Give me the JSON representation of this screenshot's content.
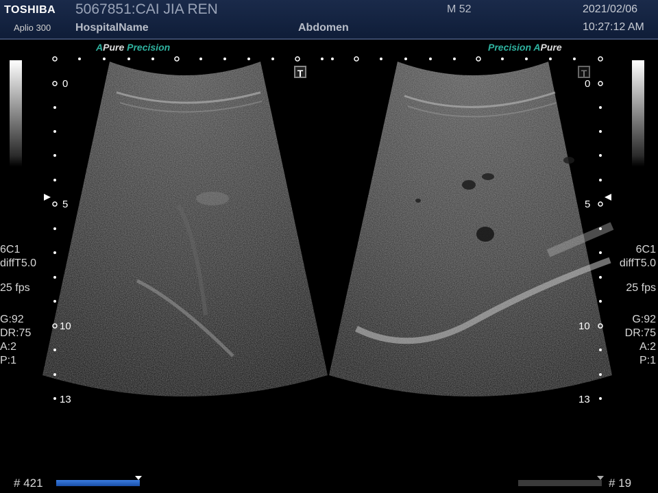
{
  "header": {
    "brand": "TOSHIBA",
    "model": "Aplio 300",
    "patient": "5067851:CAI JIA REN",
    "hospital": "HospitalName",
    "sex_age": "M 52",
    "exam": "Abdomen",
    "date": "2021/02/06",
    "time": "10:27:12 AM"
  },
  "left_view": {
    "tag_a": "A",
    "tag_pure": "Pure",
    "tag_precision": "Precision",
    "depth_marks": [
      "0",
      "5",
      "10",
      "13"
    ],
    "probe": "6C1",
    "mode": "diffT5.0",
    "fps": "25 fps",
    "gain": "G:92",
    "dr": "DR:75",
    "a": "A:2",
    "p": "P:1",
    "frame": "# 421"
  },
  "right_view": {
    "tag_precision": "Precision",
    "tag_a": "A",
    "tag_pure": "Pure",
    "depth_marks": [
      "0",
      "5",
      "10",
      "13"
    ],
    "probe": "6C1",
    "mode": "diffT5.0",
    "fps": "25 fps",
    "gain": "G:92",
    "dr": "DR:75",
    "a": "A:2",
    "p": "P:1",
    "frame": "# 19"
  },
  "icons": {
    "t_marker": "T"
  },
  "colors": {
    "header_bg": "#13234a",
    "accent_teal": "#2fb3a0",
    "cine_bar_active": "#2a6cd0"
  }
}
